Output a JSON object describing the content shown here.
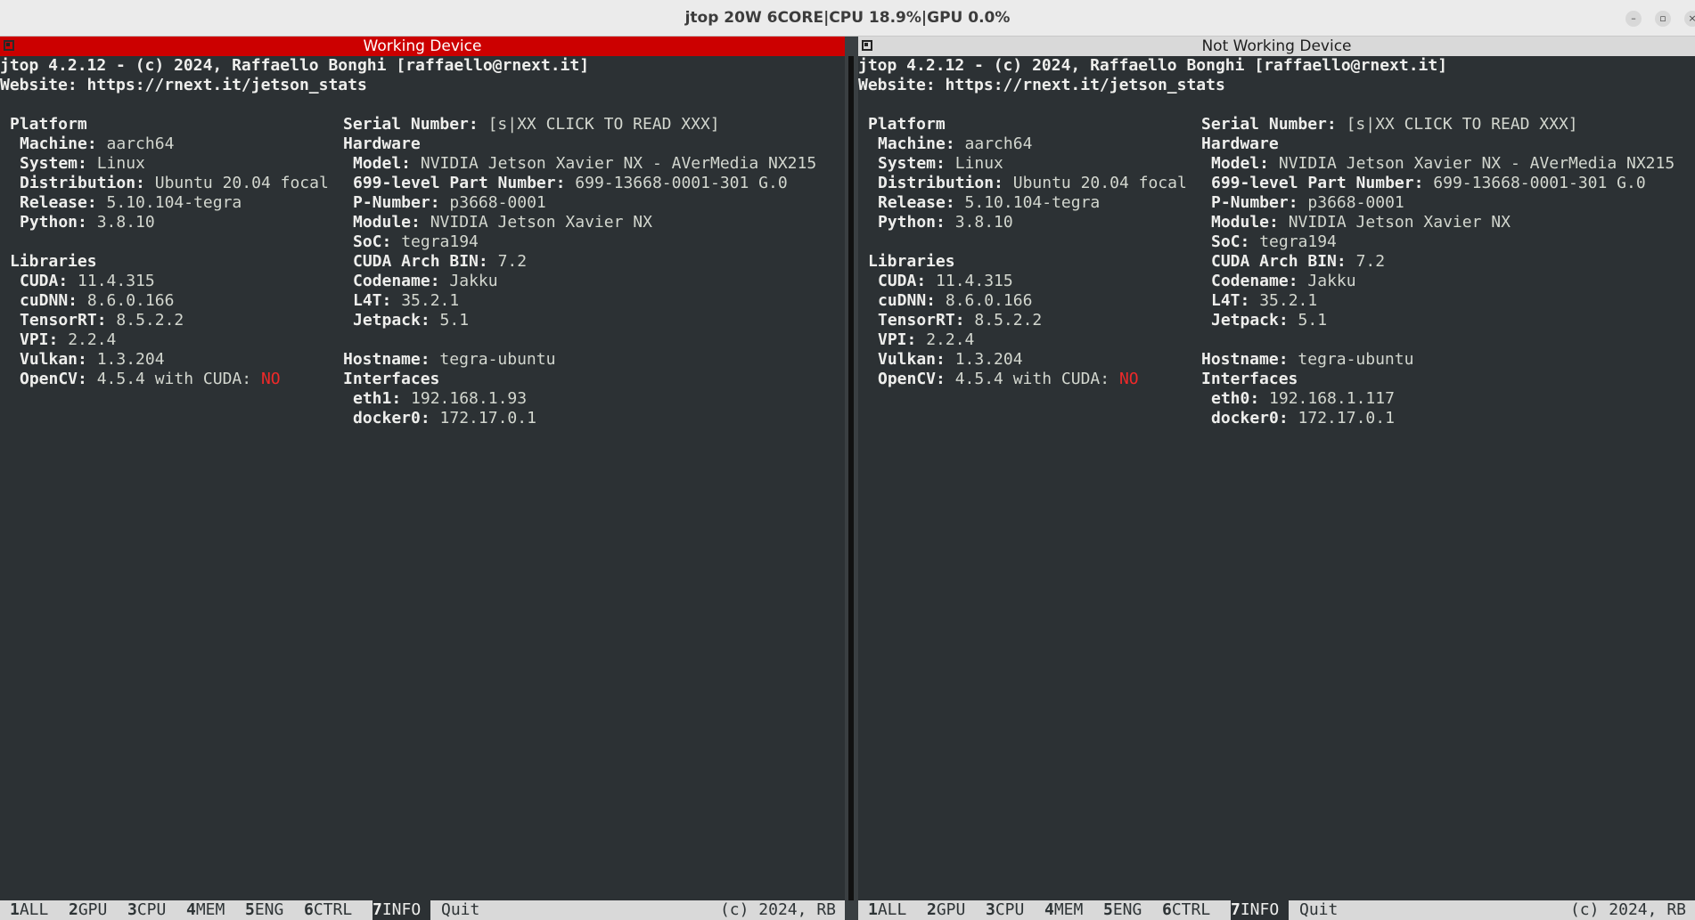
{
  "window": {
    "title": "jtop 20W 6CORE|CPU 18.9%|GPU 0.0%",
    "controls": [
      "minimize",
      "restore",
      "close"
    ]
  },
  "panes": [
    {
      "header": "Working Device",
      "header_color": "#cc0000",
      "line1": "jtop 4.2.12 - (c) 2024, Raffaello Bonghi [raffaello@rnext.it]",
      "line2": "Website: https://rnext.it/jetson_stats",
      "platform": {
        "heading": "Platform",
        "machine_label": "Machine:",
        "machine": "aarch64",
        "system_label": "System:",
        "system": "Linux",
        "distribution_label": "Distribution:",
        "distribution": "Ubuntu 20.04 focal",
        "release_label": "Release:",
        "release": "5.10.104-tegra",
        "python_label": "Python:",
        "python": "3.8.10"
      },
      "libraries": {
        "heading": "Libraries",
        "cuda_label": "CUDA:",
        "cuda": "11.4.315",
        "cudnn_label": "cuDNN:",
        "cudnn": "8.6.0.166",
        "tensorrt_label": "TensorRT:",
        "tensorrt": "8.5.2.2",
        "vpi_label": "VPI:",
        "vpi": "2.2.4",
        "vulkan_label": "Vulkan:",
        "vulkan": "1.3.204",
        "opencv_label": "OpenCV:",
        "opencv": "4.5.4 with CUDA:",
        "opencv_cuda": "NO"
      },
      "hardware": {
        "serial_label": "Serial Number:",
        "serial": "[s|XX CLICK TO READ XXX]",
        "heading": "Hardware",
        "model_label": "Model:",
        "model": "NVIDIA Jetson Xavier NX - AVerMedia NX215",
        "part_label": "699-level Part Number:",
        "part": "699-13668-0001-301 G.0",
        "pnumber_label": "P-Number:",
        "pnumber": "p3668-0001",
        "module_label": "Module:",
        "module": "NVIDIA Jetson Xavier NX",
        "soc_label": "SoC:",
        "soc": "tegra194",
        "arch_label": "CUDA Arch BIN:",
        "arch": "7.2",
        "codename_label": "Codename:",
        "codename": "Jakku",
        "l4t_label": "L4T:",
        "l4t": "35.2.1",
        "jetpack_label": "Jetpack:",
        "jetpack": "5.1"
      },
      "network": {
        "hostname_label": "Hostname:",
        "hostname": "tegra-ubuntu",
        "interfaces_heading": "Interfaces",
        "if1_label": "eth1:",
        "if1": "192.168.1.93",
        "if2_label": "docker0:",
        "if2": "172.17.0.1"
      },
      "bottombar": {
        "tabs": [
          {
            "num": "1",
            "label": "ALL"
          },
          {
            "num": "2",
            "label": "GPU"
          },
          {
            "num": "3",
            "label": "CPU"
          },
          {
            "num": "4",
            "label": "MEM"
          },
          {
            "num": "5",
            "label": "ENG"
          },
          {
            "num": "6",
            "label": "CTRL"
          },
          {
            "num": "7",
            "label": "INFO"
          }
        ],
        "quit": "Quit",
        "copyright": "(c) 2024, RB"
      }
    },
    {
      "header": "Not Working Device",
      "header_color": "#d9d9d9",
      "line1": "jtop 4.2.12 - (c) 2024, Raffaello Bonghi [raffaello@rnext.it]",
      "line2": "Website: https://rnext.it/jetson_stats",
      "platform": {
        "heading": "Platform",
        "machine_label": "Machine:",
        "machine": "aarch64",
        "system_label": "System:",
        "system": "Linux",
        "distribution_label": "Distribution:",
        "distribution": "Ubuntu 20.04 focal",
        "release_label": "Release:",
        "release": "5.10.104-tegra",
        "python_label": "Python:",
        "python": "3.8.10"
      },
      "libraries": {
        "heading": "Libraries",
        "cuda_label": "CUDA:",
        "cuda": "11.4.315",
        "cudnn_label": "cuDNN:",
        "cudnn": "8.6.0.166",
        "tensorrt_label": "TensorRT:",
        "tensorrt": "8.5.2.2",
        "vpi_label": "VPI:",
        "vpi": "2.2.4",
        "vulkan_label": "Vulkan:",
        "vulkan": "1.3.204",
        "opencv_label": "OpenCV:",
        "opencv": "4.5.4 with CUDA:",
        "opencv_cuda": "NO"
      },
      "hardware": {
        "serial_label": "Serial Number:",
        "serial": "[s|XX CLICK TO READ XXX]",
        "heading": "Hardware",
        "model_label": "Model:",
        "model": "NVIDIA Jetson Xavier NX - AVerMedia NX215",
        "part_label": "699-level Part Number:",
        "part": "699-13668-0001-301 G.0",
        "pnumber_label": "P-Number:",
        "pnumber": "p3668-0001",
        "module_label": "Module:",
        "module": "NVIDIA Jetson Xavier NX",
        "soc_label": "SoC:",
        "soc": "tegra194",
        "arch_label": "CUDA Arch BIN:",
        "arch": "7.2",
        "codename_label": "Codename:",
        "codename": "Jakku",
        "l4t_label": "L4T:",
        "l4t": "35.2.1",
        "jetpack_label": "Jetpack:",
        "jetpack": "5.1"
      },
      "network": {
        "hostname_label": "Hostname:",
        "hostname": "tegra-ubuntu",
        "interfaces_heading": "Interfaces",
        "if1_label": "eth0:",
        "if1": "192.168.1.117",
        "if2_label": "docker0:",
        "if2": "172.17.0.1"
      },
      "bottombar": {
        "tabs": [
          {
            "num": "1",
            "label": "ALL"
          },
          {
            "num": "2",
            "label": "GPU"
          },
          {
            "num": "3",
            "label": "CPU"
          },
          {
            "num": "4",
            "label": "MEM"
          },
          {
            "num": "5",
            "label": "ENG"
          },
          {
            "num": "6",
            "label": "CTRL"
          },
          {
            "num": "7",
            "label": "INFO"
          }
        ],
        "quit": "Quit",
        "copyright": "(c) 2024, RB"
      }
    }
  ],
  "active_tab": "INFO",
  "colors": {
    "terminal_bg": "#2c3134",
    "text": "#d3d7cf",
    "alert": "#ef2929",
    "active_header": "#cc0000"
  }
}
